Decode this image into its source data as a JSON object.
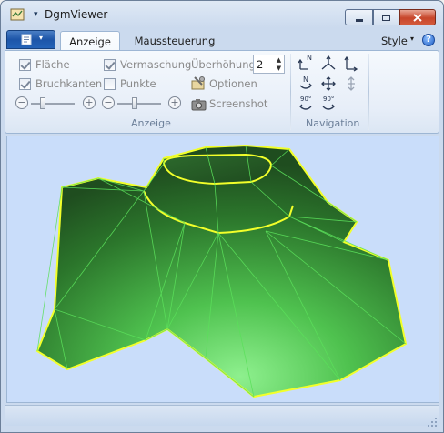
{
  "window": {
    "title": "DgmViewer",
    "title_menu_glyph": "▾",
    "app_icon": "map-icon",
    "controls": {
      "minimize": "minimize-icon",
      "maximize": "maximize-icon",
      "close": "close-icon"
    }
  },
  "ribbon": {
    "app_menu_icon": "document-icon",
    "app_menu_arrow": "▾",
    "tabs": [
      {
        "label": "Anzeige",
        "active": true
      },
      {
        "label": "Maussteuerung",
        "active": false
      }
    ],
    "style_label": "Style",
    "style_arrow": "▾",
    "help_glyph": "?",
    "groups": {
      "anzeige": {
        "label": "Anzeige",
        "flaeche": {
          "label": "Fläche",
          "checked": true
        },
        "bruchkanten": {
          "label": "Bruchkanten",
          "checked": true
        },
        "vermaschung": {
          "label": "Vermaschung",
          "checked": true
        },
        "punkte": {
          "label": "Punkte",
          "checked": false
        },
        "ueberhoehung": {
          "label": "Überhöhung",
          "value": "2"
        },
        "optionen": {
          "label": "Optionen",
          "icon": "options-icon"
        },
        "screenshot": {
          "label": "Screenshot",
          "icon": "camera-icon"
        },
        "zoom_minus": "−",
        "zoom_plus": "+"
      },
      "navigation": {
        "label": "Navigation",
        "north_top_label": "N",
        "north_mid_label": "N",
        "rot_label": "90°"
      }
    }
  },
  "colors": {
    "terrain_dark": "#1f4d1f",
    "terrain_light": "#8ef08e",
    "breakline": "#f2ff2a",
    "mesh": "#5be05b",
    "viewport_bg": "#c9ddfa"
  }
}
